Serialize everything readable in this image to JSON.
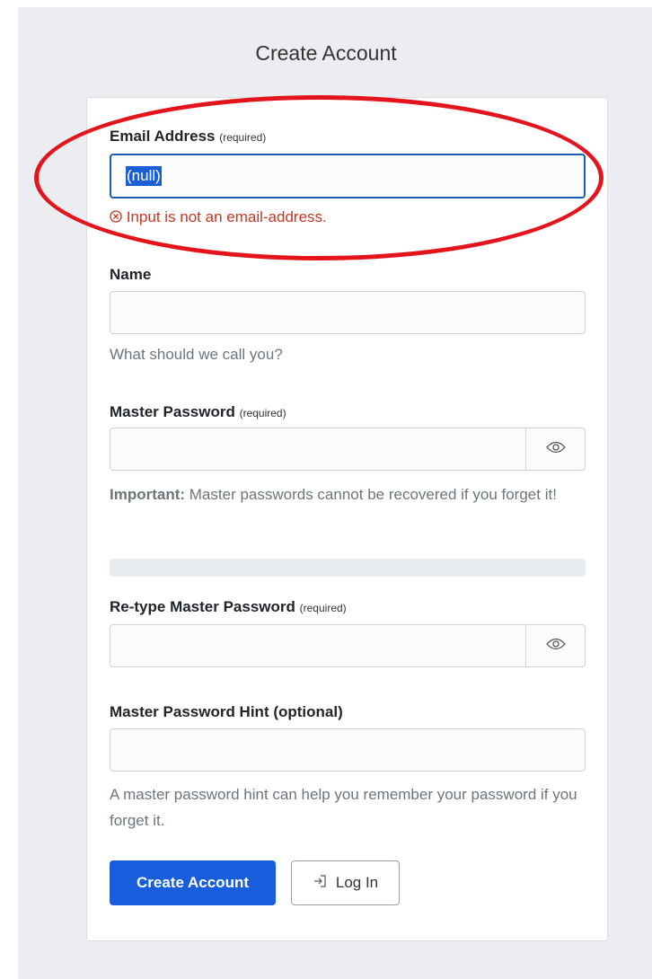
{
  "page": {
    "title": "Create Account"
  },
  "email": {
    "label": "Email Address",
    "required": "(required)",
    "value": "(null)",
    "error": "Input is not an email-address."
  },
  "name": {
    "label": "Name",
    "help": "What should we call you?"
  },
  "master_password": {
    "label": "Master Password",
    "required": "(required)",
    "help_bold": "Important:",
    "help": " Master passwords cannot be recovered if you forget it!"
  },
  "retype_password": {
    "label": "Re-type Master Password",
    "required": "(required)"
  },
  "hint": {
    "label": "Master Password Hint (optional)",
    "help": "A master password hint can help you remember your password if you forget it."
  },
  "buttons": {
    "create": "Create Account",
    "login": "Log In"
  },
  "icons": {
    "eye": "eye-icon",
    "error": "error-circle-icon",
    "login": "sign-in-icon"
  },
  "colors": {
    "primary": "#175ddc",
    "error": "#c83522",
    "annotation": "#e3141b"
  }
}
